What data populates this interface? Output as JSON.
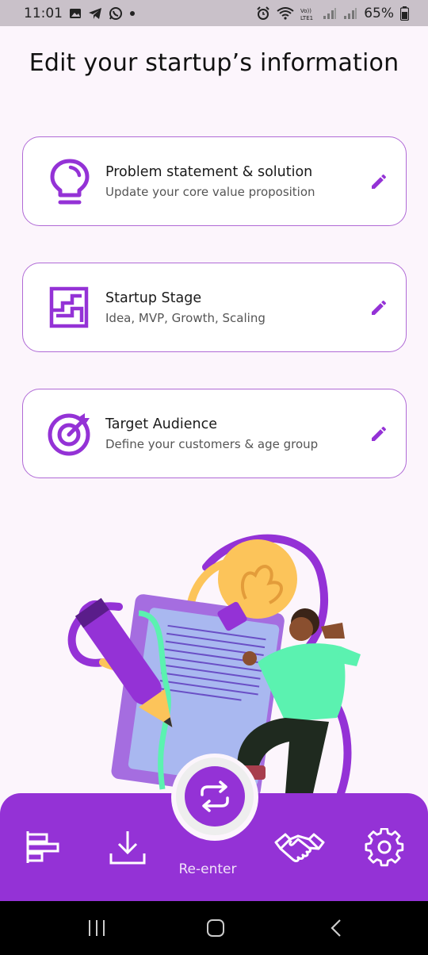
{
  "status": {
    "time": "11:01",
    "battery": "65%"
  },
  "title": "Edit your startup’s information",
  "cards": [
    {
      "title": "Problem statement & solution",
      "subtitle": "Update your core value proposition",
      "icon": "lightbulb-icon"
    },
    {
      "title": "Startup Stage",
      "subtitle": "Idea, MVP, Growth, Scaling",
      "icon": "stairs-icon"
    },
    {
      "title": "Target Audience",
      "subtitle": "Define your customers & age group",
      "icon": "target-icon"
    }
  ],
  "bottom_nav": {
    "center_label": "Re-enter",
    "items": [
      "chart-bars-icon",
      "download-icon",
      "repeat-icon",
      "handshake-icon",
      "gear-icon"
    ]
  },
  "colors": {
    "accent": "#9432d6",
    "card_border": "#b06ad6",
    "background": "#fcf5fc"
  }
}
